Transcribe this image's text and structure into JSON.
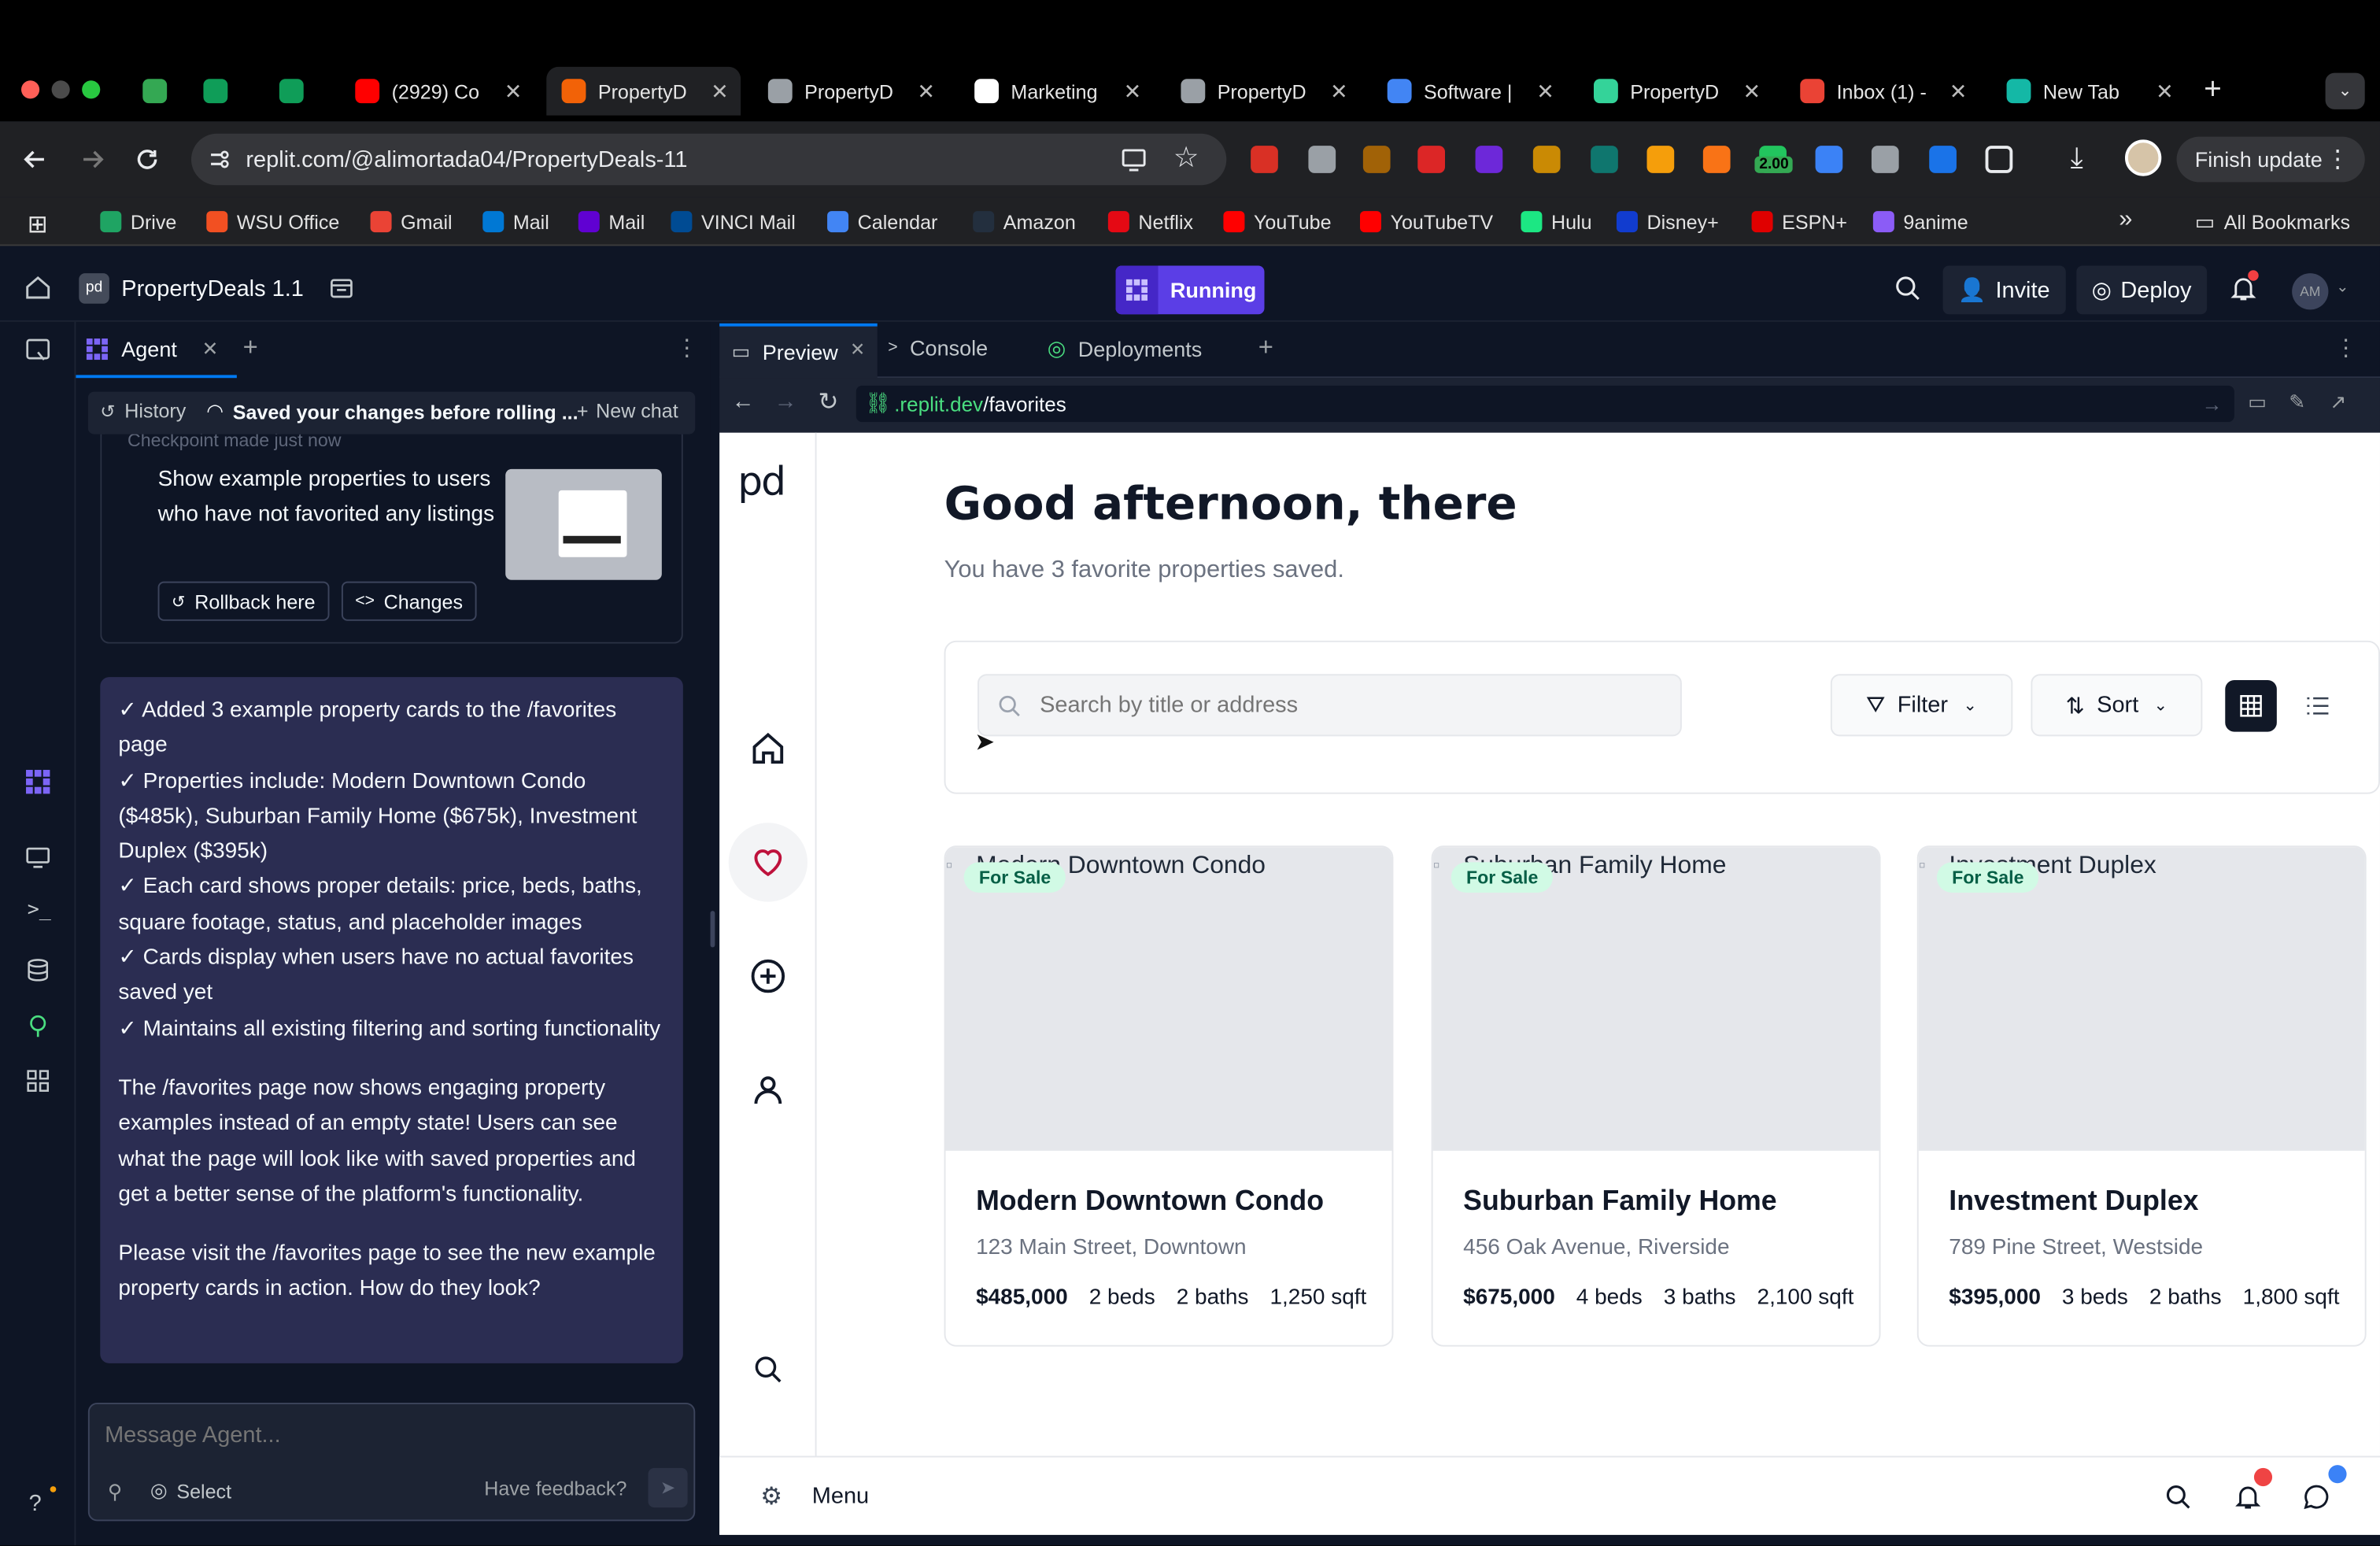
{
  "browser": {
    "tabs": [
      {
        "title": "",
        "icon": "p-icon",
        "color": "#34a853"
      },
      {
        "title": "",
        "icon": "sheets-icon",
        "color": "#0f9d58"
      },
      {
        "title": "",
        "icon": "sheets-icon",
        "color": "#0f9d58"
      },
      {
        "title": "(2929) Co",
        "icon": "youtube-icon",
        "color": "#ff0000"
      },
      {
        "title": "PropertyD",
        "icon": "replit-icon",
        "color": "#f26207",
        "active": true
      },
      {
        "title": "PropertyD",
        "icon": "globe-icon",
        "color": "#9aa0a6"
      },
      {
        "title": "Marketing",
        "icon": "openai-icon",
        "color": "#ffffff"
      },
      {
        "title": "PropertyD",
        "icon": "globe-icon",
        "color": "#9aa0a6"
      },
      {
        "title": "Software |",
        "icon": "docs-icon",
        "color": "#4285f4"
      },
      {
        "title": "PropertyD",
        "icon": "replit-agent-icon",
        "color": "#34d399"
      },
      {
        "title": "Inbox (1) -",
        "icon": "gmail-icon",
        "color": "#ea4335"
      },
      {
        "title": "New Tab",
        "icon": "m-icon",
        "color": "#14b8a6"
      }
    ],
    "url": "replit.com/@alimortada04/PropertyDeals-11",
    "finish_update": "Finish update",
    "badge_value": "2.00",
    "bookmarks": [
      {
        "label": "Drive",
        "color": "#1fa463"
      },
      {
        "label": "WSU Office",
        "color": "#f25022"
      },
      {
        "label": "Gmail",
        "color": "#ea4335"
      },
      {
        "label": "Mail",
        "color": "#0078d4"
      },
      {
        "label": "Mail",
        "color": "#6001d2"
      },
      {
        "label": "VINCI Mail",
        "color": "#004b93"
      },
      {
        "label": "Calendar",
        "color": "#4285f4"
      },
      {
        "label": "Amazon",
        "color": "#232f3e"
      },
      {
        "label": "Netflix",
        "color": "#e50914"
      },
      {
        "label": "YouTube",
        "color": "#ff0000"
      },
      {
        "label": "YouTubeTV",
        "color": "#ff0000"
      },
      {
        "label": "Hulu",
        "color": "#1ce783"
      },
      {
        "label": "Disney+",
        "color": "#113ccf"
      },
      {
        "label": "ESPN+",
        "color": "#e00000"
      },
      {
        "label": "9anime",
        "color": "#8b5cf6"
      }
    ],
    "all_bookmarks": "All Bookmarks"
  },
  "replit": {
    "project_name": "PropertyDeals 1.1",
    "status": "Running",
    "invite": "Invite",
    "deploy": "Deploy",
    "avatar_initials": "AM",
    "agent_tab": "Agent",
    "history": "History",
    "saved_changes": "Saved your changes before rolling ...",
    "new_chat": "New chat",
    "checkpoint_text": "Checkpoint made just now",
    "checkpoint_message": "Show example properties to users who have not favorited any listings",
    "rollback": "Rollback here",
    "changes": "Changes",
    "agent_message": {
      "bullets": [
        "✓ Added 3 example property cards to the /favorites page",
        "✓ Properties include: Modern Downtown Condo ($485k), Suburban Family Home ($675k), Investment Duplex ($395k)",
        "✓ Each card shows proper details: price, beds, baths, square footage, status, and placeholder images",
        "✓ Cards display when users have no actual favorites saved yet",
        "✓ Maintains all existing filtering and sorting functionality"
      ],
      "paragraph1": "The /favorites page now shows engaging property examples instead of an empty state! Users can see what the page will look like with saved properties and get a better sense of the platform's functionality.",
      "paragraph2": "Please visit the /favorites page to see the new example property cards in action. How do they look?"
    },
    "composer_placeholder": "Message Agent...",
    "select": "Select",
    "feedback": "Have feedback?",
    "preview_tabs": [
      "Preview",
      "Console",
      "Deployments"
    ],
    "preview_url_domain": ".replit.dev",
    "preview_url_path": "/favorites"
  },
  "site": {
    "logo": "pd",
    "greeting": "Good afternoon, there",
    "subtitle": "You have 3 favorite properties saved.",
    "search_placeholder": "Search by title or address",
    "filter": "Filter",
    "sort": "Sort",
    "menu": "Menu",
    "properties": [
      {
        "title": "Modern Downtown Condo",
        "address": "123 Main Street, Downtown",
        "price": "$485,000",
        "beds": "2 beds",
        "baths": "2 baths",
        "sqft": "1,250 sqft",
        "status": "For Sale"
      },
      {
        "title": "Suburban Family Home",
        "address": "456 Oak Avenue, Riverside",
        "price": "$675,000",
        "beds": "4 beds",
        "baths": "3 baths",
        "sqft": "2,100 sqft",
        "status": "For Sale"
      },
      {
        "title": "Investment Duplex",
        "address": "789 Pine Street, Westside",
        "price": "$395,000",
        "beds": "3 beds",
        "baths": "2 baths",
        "sqft": "1,800 sqft",
        "status": "For Sale"
      }
    ]
  },
  "colors": {
    "replit_bg": "#0e1525",
    "running_purple": "#5b3ee6",
    "agent_message_bg": "#2b2d52",
    "site_primary": "#111827",
    "for_sale_badge": "#d1fae5"
  }
}
